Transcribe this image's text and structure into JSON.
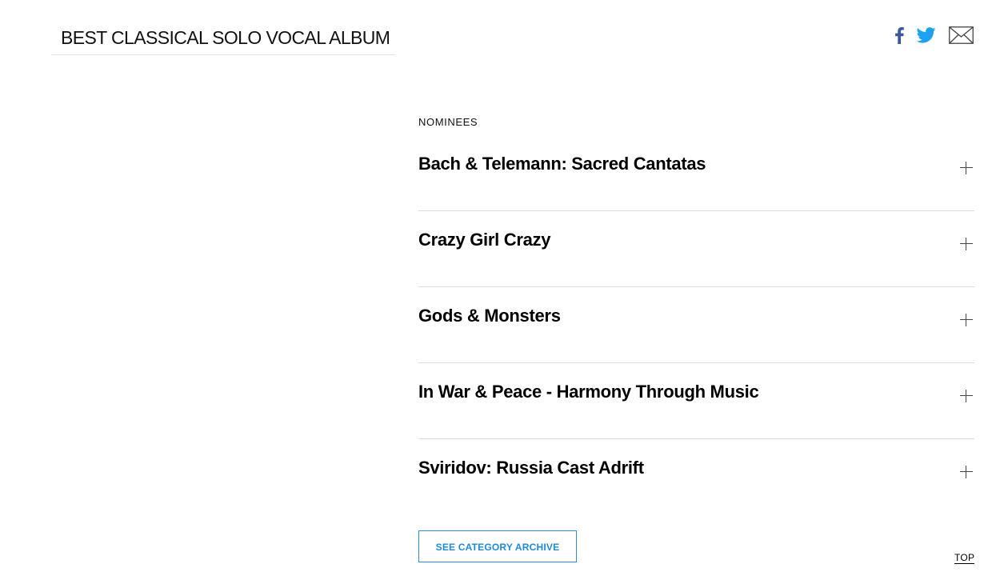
{
  "category": {
    "title": "BEST CLASSICAL SOLO VOCAL ALBUM"
  },
  "share": {
    "facebook_icon": "facebook-icon",
    "twitter_icon": "twitter-icon",
    "email_icon": "email-icon",
    "colors": {
      "facebook": "#3b5998",
      "twitter": "#1da1f2",
      "email": "#444444"
    }
  },
  "nominees": {
    "label": "NOMINEES",
    "items": [
      {
        "title": "Bach & Telemann: Sacred Cantatas"
      },
      {
        "title": "Crazy Girl Crazy"
      },
      {
        "title": "Gods & Monsters"
      },
      {
        "title": "In War & Peace - Harmony Through Music"
      },
      {
        "title": "Sviridov: Russia Cast Adrift"
      }
    ],
    "expand_icon": "plus-icon"
  },
  "archive_button": {
    "label": "SEE CATEGORY ARCHIVE",
    "color": "#1f8ad8"
  },
  "top_link": {
    "label": "TOP"
  }
}
